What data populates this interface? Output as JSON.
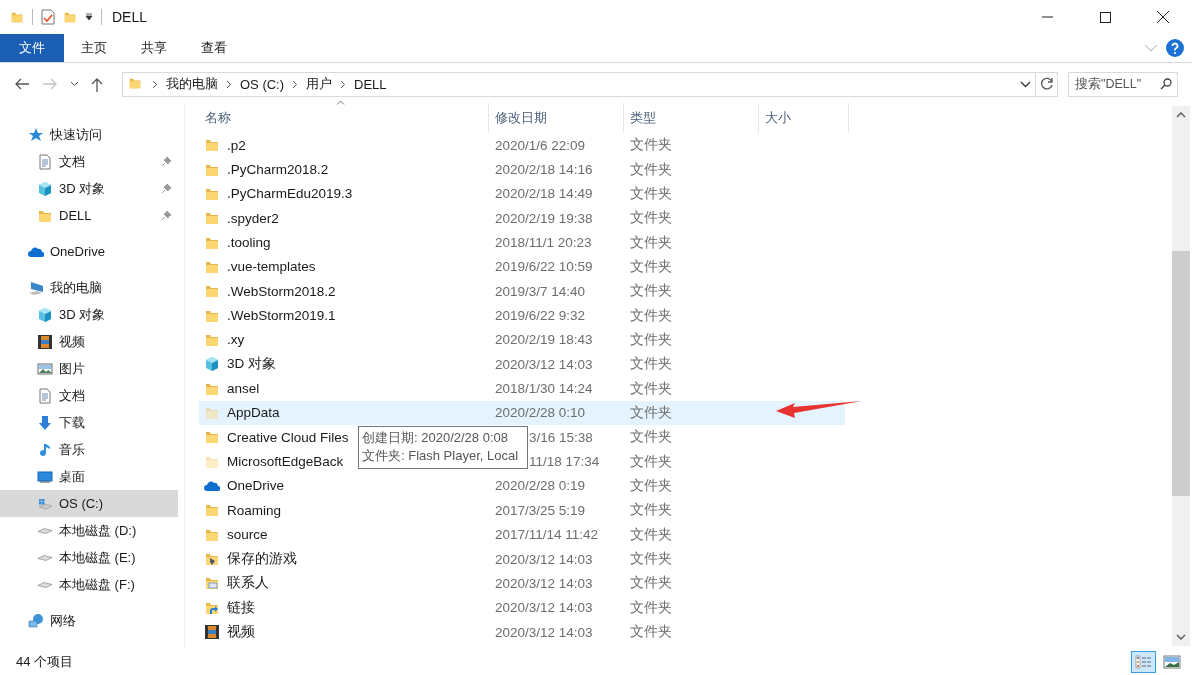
{
  "window": {
    "title": "DELL"
  },
  "ribbon": {
    "tabs": [
      {
        "label": "文件",
        "selected": true
      },
      {
        "label": "主页",
        "selected": false
      },
      {
        "label": "共享",
        "selected": false
      },
      {
        "label": "查看",
        "selected": false
      }
    ]
  },
  "address_bar": {
    "forward_enabled": false,
    "breadcrumb": [
      "我的电脑",
      "OS (C:)",
      "用户",
      "DELL"
    ],
    "search": {
      "placeholder": "搜索\"DELL\""
    }
  },
  "navigation_pane": {
    "sections": [
      {
        "label": "快速访问",
        "kind": "star",
        "selected": false,
        "children": [
          {
            "label": "文档",
            "kind": "document",
            "pinned": true,
            "selected": false
          },
          {
            "label": "3D 对象",
            "kind": "cube",
            "pinned": true,
            "selected": false
          },
          {
            "label": "DELL",
            "kind": "folder",
            "pinned": true,
            "selected": false
          }
        ]
      },
      {
        "label": "OneDrive",
        "kind": "cloud",
        "selected": false
      },
      {
        "label": "我的电脑",
        "kind": "computer",
        "selected": false,
        "children": [
          {
            "label": "3D 对象",
            "kind": "cube",
            "pinned": false,
            "selected": false
          },
          {
            "label": "视频",
            "kind": "film",
            "pinned": false,
            "selected": false
          },
          {
            "label": "图片",
            "kind": "image",
            "pinned": false,
            "selected": false
          },
          {
            "label": "文档",
            "kind": "document",
            "pinned": false,
            "selected": false
          },
          {
            "label": "下载",
            "kind": "download",
            "pinned": false,
            "selected": false
          },
          {
            "label": "音乐",
            "kind": "music",
            "pinned": false,
            "selected": false
          },
          {
            "label": "桌面",
            "kind": "desktop",
            "pinned": false,
            "selected": false
          },
          {
            "label": "OS (C:)",
            "kind": "system-drive",
            "pinned": false,
            "selected": true
          },
          {
            "label": "本地磁盘 (D:)",
            "kind": "drive",
            "pinned": false,
            "selected": false
          },
          {
            "label": "本地磁盘 (E:)",
            "kind": "drive",
            "pinned": false,
            "selected": false
          },
          {
            "label": "本地磁盘 (F:)",
            "kind": "drive",
            "pinned": false,
            "selected": false
          }
        ]
      },
      {
        "label": "网络",
        "kind": "network",
        "selected": false
      }
    ]
  },
  "file_list": {
    "columns": [
      {
        "label": "名称",
        "sorted": true
      },
      {
        "label": "修改日期",
        "sorted": false
      },
      {
        "label": "类型",
        "sorted": false
      },
      {
        "label": "大小",
        "sorted": false
      }
    ],
    "rows": [
      {
        "name": ".p2",
        "kind": "folder",
        "modified": "2020/1/6 22:09",
        "type": "文件夹",
        "faded": false,
        "highlighted": false,
        "covered": false
      },
      {
        "name": ".PyCharm2018.2",
        "kind": "folder",
        "modified": "2020/2/18 14:16",
        "type": "文件夹",
        "faded": false,
        "highlighted": false,
        "covered": false
      },
      {
        "name": ".PyCharmEdu2019.3",
        "kind": "folder",
        "modified": "2020/2/18 14:49",
        "type": "文件夹",
        "faded": false,
        "highlighted": false,
        "covered": false
      },
      {
        "name": ".spyder2",
        "kind": "folder",
        "modified": "2020/2/19 19:38",
        "type": "文件夹",
        "faded": false,
        "highlighted": false,
        "covered": false
      },
      {
        "name": ".tooling",
        "kind": "folder",
        "modified": "2018/11/1 20:23",
        "type": "文件夹",
        "faded": false,
        "highlighted": false,
        "covered": false
      },
      {
        "name": ".vue-templates",
        "kind": "folder",
        "modified": "2019/6/22 10:59",
        "type": "文件夹",
        "faded": false,
        "highlighted": false,
        "covered": false
      },
      {
        "name": ".WebStorm2018.2",
        "kind": "folder",
        "modified": "2019/3/7 14:40",
        "type": "文件夹",
        "faded": false,
        "highlighted": false,
        "covered": false
      },
      {
        "name": ".WebStorm2019.1",
        "kind": "folder",
        "modified": "2019/6/22 9:32",
        "type": "文件夹",
        "faded": false,
        "highlighted": false,
        "covered": false
      },
      {
        "name": ".xy",
        "kind": "folder",
        "modified": "2020/2/19 18:43",
        "type": "文件夹",
        "faded": false,
        "highlighted": false,
        "covered": false
      },
      {
        "name": "3D 对象",
        "kind": "cube",
        "modified": "2020/3/12 14:03",
        "type": "文件夹",
        "faded": false,
        "highlighted": false,
        "covered": false
      },
      {
        "name": "ansel",
        "kind": "folder",
        "modified": "2018/1/30 14:24",
        "type": "文件夹",
        "faded": false,
        "highlighted": false,
        "covered": false
      },
      {
        "name": "AppData",
        "kind": "folder",
        "modified": "2020/2/28 0:10",
        "type": "文件夹",
        "faded": true,
        "highlighted": true,
        "covered": false
      },
      {
        "name": "Creative Cloud Files",
        "kind": "folder",
        "modified": "3/16 15:38",
        "type": "文件夹",
        "faded": false,
        "highlighted": false,
        "covered": true
      },
      {
        "name": "MicrosoftEdgeBack",
        "kind": "folder",
        "modified": "11/18 17:34",
        "type": "文件夹",
        "faded": true,
        "highlighted": false,
        "covered": true
      },
      {
        "name": "OneDrive",
        "kind": "cloud",
        "modified": "2020/2/28 0:19",
        "type": "文件夹",
        "faded": false,
        "highlighted": false,
        "covered": false
      },
      {
        "name": "Roaming",
        "kind": "folder",
        "modified": "2017/3/25 5:19",
        "type": "文件夹",
        "faded": false,
        "highlighted": false,
        "covered": false
      },
      {
        "name": "source",
        "kind": "folder",
        "modified": "2017/11/14 11:42",
        "type": "文件夹",
        "faded": false,
        "highlighted": false,
        "covered": false
      },
      {
        "name": "保存的游戏",
        "kind": "games",
        "modified": "2020/3/12 14:03",
        "type": "文件夹",
        "faded": false,
        "highlighted": false,
        "covered": false
      },
      {
        "name": "联系人",
        "kind": "contacts",
        "modified": "2020/3/12 14:03",
        "type": "文件夹",
        "faded": false,
        "highlighted": false,
        "covered": false
      },
      {
        "name": "链接",
        "kind": "links",
        "modified": "2020/3/12 14:03",
        "type": "文件夹",
        "faded": false,
        "highlighted": false,
        "covered": false
      },
      {
        "name": "视频",
        "kind": "film",
        "modified": "2020/3/12 14:03",
        "type": "文件夹",
        "faded": false,
        "highlighted": false,
        "covered": false
      }
    ]
  },
  "tooltip": {
    "lines": [
      "创建日期: 2020/2/28 0:08",
      "文件夹: Flash Player, Local"
    ]
  },
  "status_bar": {
    "item_count": "44 个项目",
    "views": [
      {
        "kind": "details",
        "selected": true
      },
      {
        "kind": "large-icons",
        "selected": false
      }
    ]
  }
}
